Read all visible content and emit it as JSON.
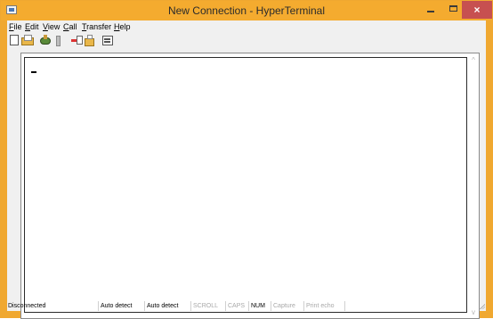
{
  "window": {
    "title": "New Connection - HyperTerminal",
    "close_glyph": "×",
    "accent_color": "#f4ab2f",
    "close_color": "#c75050"
  },
  "menu": {
    "items": [
      {
        "accel": "F",
        "rest": "ile"
      },
      {
        "accel": "E",
        "rest": "dit"
      },
      {
        "accel": "V",
        "rest": "iew"
      },
      {
        "accel": "C",
        "rest": "all"
      },
      {
        "accel": "T",
        "rest": "ransfer"
      },
      {
        "accel": "H",
        "rest": "elp"
      }
    ]
  },
  "toolbar": {
    "icons": [
      "new-icon",
      "open-icon",
      "connect-icon",
      "disconnect-icon",
      "send-icon",
      "receive-icon",
      "properties-icon"
    ]
  },
  "terminal": {
    "cursor": "_"
  },
  "scrollbar": {
    "up_glyph": "^",
    "down_glyph": "v"
  },
  "status": {
    "connection": "Disconnected",
    "detect1": "Auto detect",
    "detect2": "Auto detect",
    "scroll": "SCROLL",
    "caps": "CAPS",
    "num": "NUM",
    "capture": "Capture",
    "print_echo": "Print echo"
  }
}
